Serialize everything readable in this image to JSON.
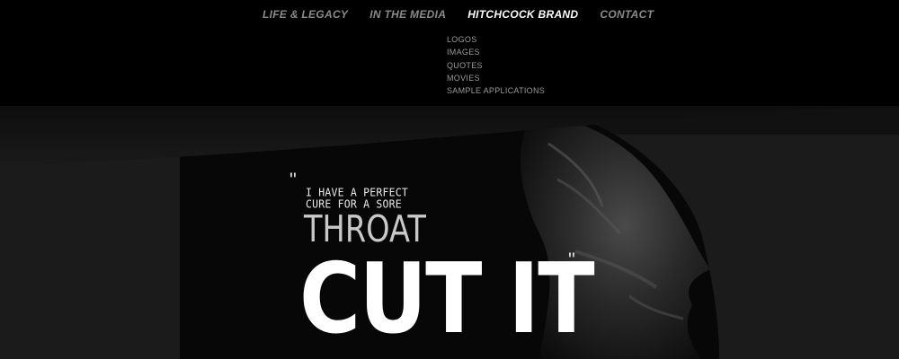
{
  "nav": {
    "items": [
      {
        "label": "LIFE & LEGACY",
        "active": false
      },
      {
        "label": "IN THE MEDIA",
        "active": false
      },
      {
        "label": "HITCHCOCK BRAND",
        "active": true
      },
      {
        "label": "CONTACT",
        "active": false
      }
    ]
  },
  "dropdown": {
    "items": [
      {
        "label": "LOGOS"
      },
      {
        "label": "IMAGES"
      },
      {
        "label": "QUOTES"
      },
      {
        "label": "MOVIES"
      },
      {
        "label": "SAMPLE APPLICATIONS"
      }
    ]
  },
  "hero": {
    "quote_open": "\"",
    "quote_line1": "I HAVE A PERFECT",
    "quote_line2": "CURE FOR A SORE",
    "quote_line3": "THROAT",
    "quote_line4": "CUT IT",
    "quote_close": "\""
  },
  "colors": {
    "background": "#000000",
    "nav_text": "#8a8a8a",
    "nav_active": "#ffffff",
    "quote_text": "#ffffff"
  }
}
